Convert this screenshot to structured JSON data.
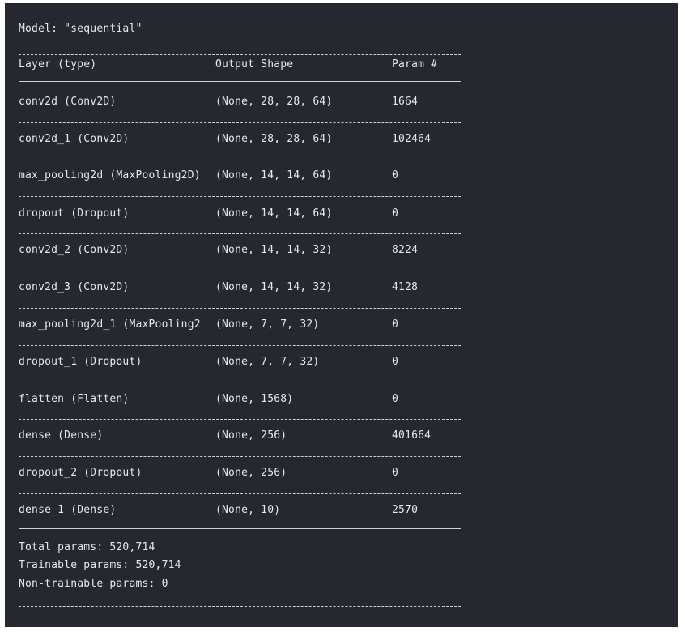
{
  "model_title": "Model: \"sequential\"",
  "headers": {
    "layer": "Layer (type)",
    "shape": "Output Shape",
    "params": "Param #"
  },
  "rows": [
    {
      "layer": "conv2d (Conv2D)",
      "shape": "(None, 28, 28, 64)",
      "params": "1664"
    },
    {
      "layer": "conv2d_1 (Conv2D)",
      "shape": "(None, 28, 28, 64)",
      "params": "102464"
    },
    {
      "layer": "max_pooling2d (MaxPooling2D)",
      "shape": "(None, 14, 14, 64)",
      "params": "0"
    },
    {
      "layer": "dropout (Dropout)",
      "shape": "(None, 14, 14, 64)",
      "params": "0"
    },
    {
      "layer": "conv2d_2 (Conv2D)",
      "shape": "(None, 14, 14, 32)",
      "params": "8224"
    },
    {
      "layer": "conv2d_3 (Conv2D)",
      "shape": "(None, 14, 14, 32)",
      "params": "4128"
    },
    {
      "layer": "max_pooling2d_1 (MaxPooling2",
      "shape": "(None, 7, 7, 32)",
      "params": "0"
    },
    {
      "layer": "dropout_1 (Dropout)",
      "shape": "(None, 7, 7, 32)",
      "params": "0"
    },
    {
      "layer": "flatten (Flatten)",
      "shape": "(None, 1568)",
      "params": "0"
    },
    {
      "layer": "dense (Dense)",
      "shape": "(None, 256)",
      "params": "401664"
    },
    {
      "layer": "dropout_2 (Dropout)",
      "shape": "(None, 256)",
      "params": "0"
    },
    {
      "layer": "dense_1 (Dense)",
      "shape": "(None, 10)",
      "params": "2570"
    }
  ],
  "summary": {
    "total": "Total params: 520,714",
    "trainable": "Trainable params: 520,714",
    "non_trainable": "Non-trainable params: 0"
  },
  "colors": {
    "background": "#262830",
    "text": "#e8e8ea"
  }
}
